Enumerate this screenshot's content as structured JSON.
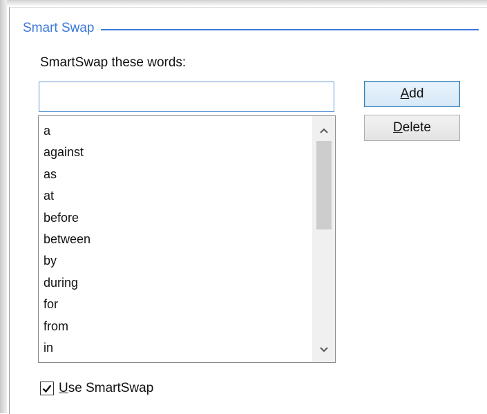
{
  "group": {
    "title": "Smart Swap"
  },
  "prompt": {
    "label": "SmartSwap these words:"
  },
  "word_input": {
    "value": "",
    "placeholder": ""
  },
  "buttons": {
    "add": {
      "access_key": "A",
      "rest": "dd"
    },
    "delete": {
      "access_key": "D",
      "rest": "elete"
    }
  },
  "word_list": {
    "items": [
      "a",
      "against",
      "as",
      "at",
      "before",
      "between",
      "by",
      "during",
      "for",
      "from",
      "in"
    ],
    "scroll_position": 0.0
  },
  "use_smartswap": {
    "checked": true,
    "access_key": "U",
    "rest": "se SmartSwap"
  },
  "icons": {
    "scroll_up": "chevron-up-icon",
    "scroll_down": "chevron-down-icon",
    "check": "checkmark-icon"
  },
  "colors": {
    "accent": "#3b78d8",
    "input_border": "#5a93d8",
    "focused_button_border": "#3c7fb1"
  }
}
